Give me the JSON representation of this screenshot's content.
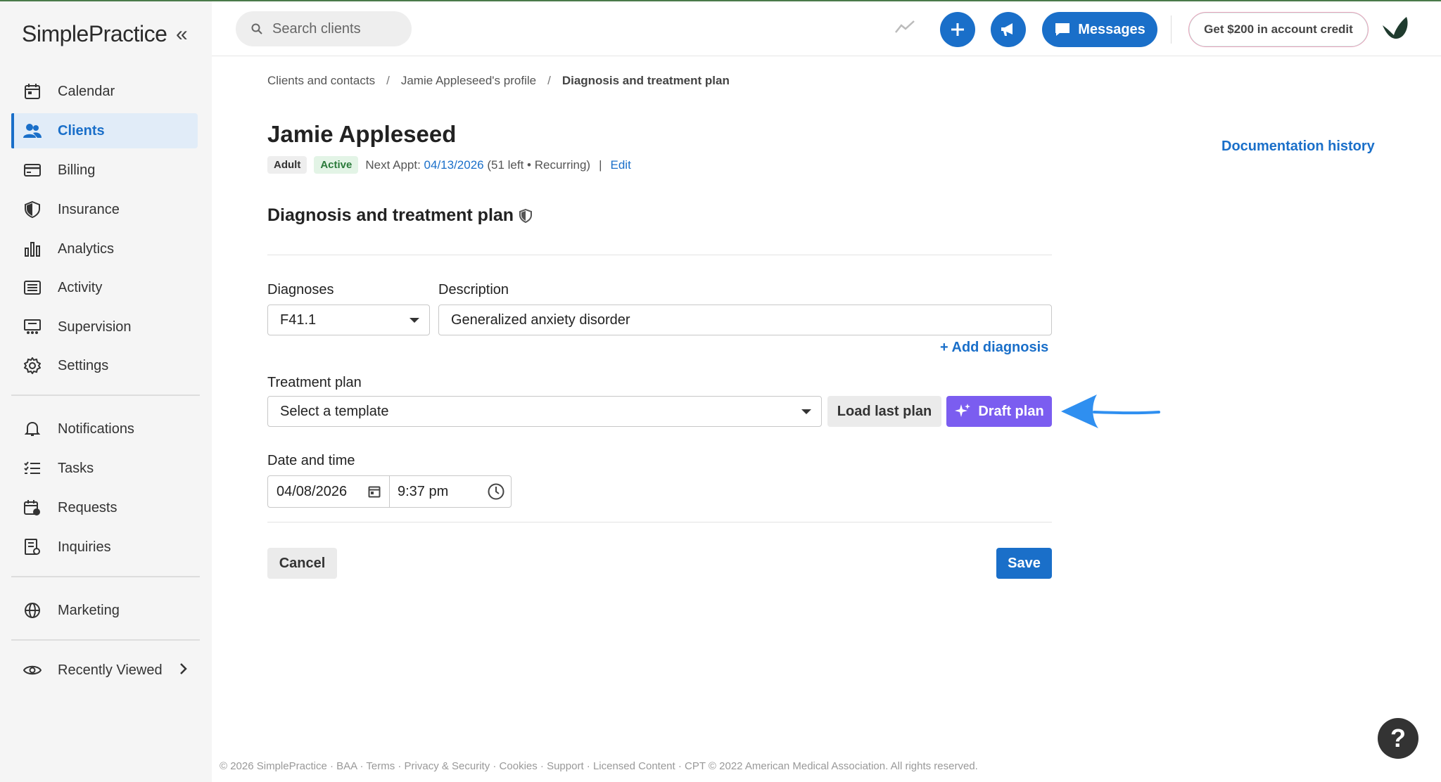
{
  "brand": {
    "logo_text": "SimplePractice"
  },
  "sidebar": {
    "collapse_icon": "«",
    "items": [
      {
        "label": "Calendar",
        "icon": "calendar-icon"
      },
      {
        "label": "Clients",
        "icon": "clients-icon",
        "active": true
      },
      {
        "label": "Billing",
        "icon": "billing-icon"
      },
      {
        "label": "Insurance",
        "icon": "shield-icon"
      },
      {
        "label": "Analytics",
        "icon": "analytics-icon"
      },
      {
        "label": "Activity",
        "icon": "activity-icon"
      },
      {
        "label": "Supervision",
        "icon": "supervision-icon"
      },
      {
        "label": "Settings",
        "icon": "gear-icon"
      },
      {
        "label": "Notifications",
        "icon": "bell-icon"
      },
      {
        "label": "Tasks",
        "icon": "tasks-icon"
      },
      {
        "label": "Requests",
        "icon": "requests-icon"
      },
      {
        "label": "Inquiries",
        "icon": "inquiries-icon"
      },
      {
        "label": "Marketing",
        "icon": "globe-icon"
      },
      {
        "label": "Recently Viewed",
        "icon": "eye-icon"
      }
    ]
  },
  "topbar": {
    "search_placeholder": "Search clients",
    "messages_label": "Messages",
    "credit_label": "Get $200 in account credit"
  },
  "breadcrumb": {
    "items": [
      "Clients and contacts",
      "Jamie Appleseed's profile",
      "Diagnosis and treatment plan"
    ],
    "separator": "/"
  },
  "client": {
    "name": "Jamie Appleseed",
    "badge_adult": "Adult",
    "badge_active": "Active",
    "next_appt_label": "Next Appt:",
    "next_appt_date": "04/13/2026",
    "next_appt_info": "(51 left • Recurring)",
    "pipe": "|",
    "edit_label": "Edit"
  },
  "doc_history_label": "Documentation history",
  "section_title": "Diagnosis and treatment plan",
  "form": {
    "diagnoses_label": "Diagnoses",
    "diagnosis_code": "F41.1",
    "description_label": "Description",
    "description_value": "Generalized anxiety disorder",
    "add_diagnosis_label": "+ Add diagnosis",
    "treatment_plan_label": "Treatment plan",
    "template_placeholder": "Select a template",
    "load_last_plan_label": "Load last plan",
    "draft_plan_label": "Draft plan",
    "date_time_label": "Date and time",
    "date_value": "04/08/2026",
    "time_value": "9:37 pm",
    "cancel_label": "Cancel",
    "save_label": "Save"
  },
  "footer": "© 2026 SimplePractice · BAA · Terms · Privacy & Security · Cookies · Support · Licensed Content · CPT © 2022 American Medical Association. All rights reserved.",
  "help_label": "?",
  "colors": {
    "primary": "#1a6fc9",
    "draft": "#7b5df0",
    "arrow": "#2f8ff0"
  }
}
